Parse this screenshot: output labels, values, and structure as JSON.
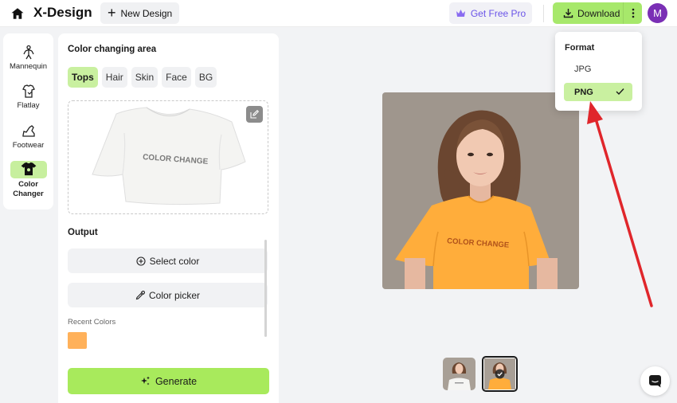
{
  "header": {
    "brand": "X-Design",
    "new_design": "New Design",
    "get_pro": "Get Free Pro",
    "download": "Download",
    "avatar_initial": "M"
  },
  "leftnav": {
    "items": [
      {
        "label": "Mannequin",
        "icon": "mannequin-icon"
      },
      {
        "label": "Flatlay",
        "icon": "flatlay-icon"
      },
      {
        "label": "Footwear",
        "icon": "footwear-icon"
      },
      {
        "label": "Color Changer",
        "icon": "tshirt-icon",
        "active": true
      }
    ],
    "color_changer_line1": "Color",
    "color_changer_line2": "Changer"
  },
  "panel": {
    "title": "Color changing area",
    "tabs": [
      {
        "label": "Tops",
        "active": true
      },
      {
        "label": "Hair"
      },
      {
        "label": "Skin"
      },
      {
        "label": "Face"
      },
      {
        "label": "BG"
      }
    ],
    "tshirt_text": "COLOR CHANGE",
    "output_label": "Output",
    "select_color": "Select color",
    "color_picker": "Color picker",
    "recent_colors_label": "Recent Colors",
    "recent_colors": [
      "#ffb15a"
    ],
    "generate": "Generate"
  },
  "preview": {
    "tshirt_text": "COLOR CHANGE",
    "shirt_color": "#ffad3b"
  },
  "dropdown": {
    "title": "Format",
    "options": [
      "JPG",
      "PNG"
    ],
    "selected": "PNG"
  },
  "colors": {
    "accent_green": "#a7e86b",
    "annotation_arrow": "#e0262b",
    "pro_purple": "#6a54e8"
  }
}
